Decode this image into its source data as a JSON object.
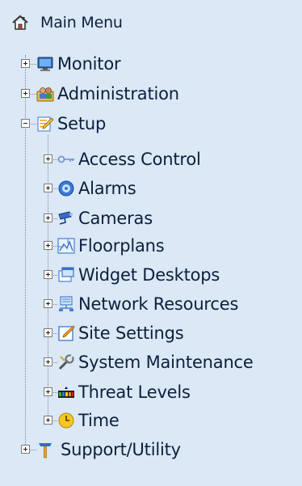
{
  "header": {
    "label": "Main Menu",
    "icon": "home-icon"
  },
  "top_items": [
    {
      "label": "Monitor",
      "icon": "monitor-icon",
      "state": "collapsed"
    },
    {
      "label": "Administration",
      "icon": "users-icon",
      "state": "collapsed"
    },
    {
      "label": "Setup",
      "icon": "setup-icon",
      "state": "expanded"
    }
  ],
  "setup_children": [
    {
      "label": "Access Control",
      "icon": "key-icon"
    },
    {
      "label": "Alarms",
      "icon": "alarm-icon"
    },
    {
      "label": "Cameras",
      "icon": "camera-icon"
    },
    {
      "label": "Floorplans",
      "icon": "floorplan-icon"
    },
    {
      "label": "Widget Desktops",
      "icon": "widget-desktop-icon"
    },
    {
      "label": "Network Resources",
      "icon": "network-icon"
    },
    {
      "label": "Site Settings",
      "icon": "site-settings-icon"
    },
    {
      "label": "System Maintenance",
      "icon": "wrench-icon"
    },
    {
      "label": "Threat Levels",
      "icon": "threat-levels-icon"
    },
    {
      "label": "Time",
      "icon": "clock-icon"
    }
  ],
  "bottom_items": [
    {
      "label": "Support/Utility",
      "icon": "tools-icon",
      "state": "collapsed"
    }
  ],
  "colors": {
    "background": "#dbe8f5",
    "text": "#0f1e3c"
  }
}
